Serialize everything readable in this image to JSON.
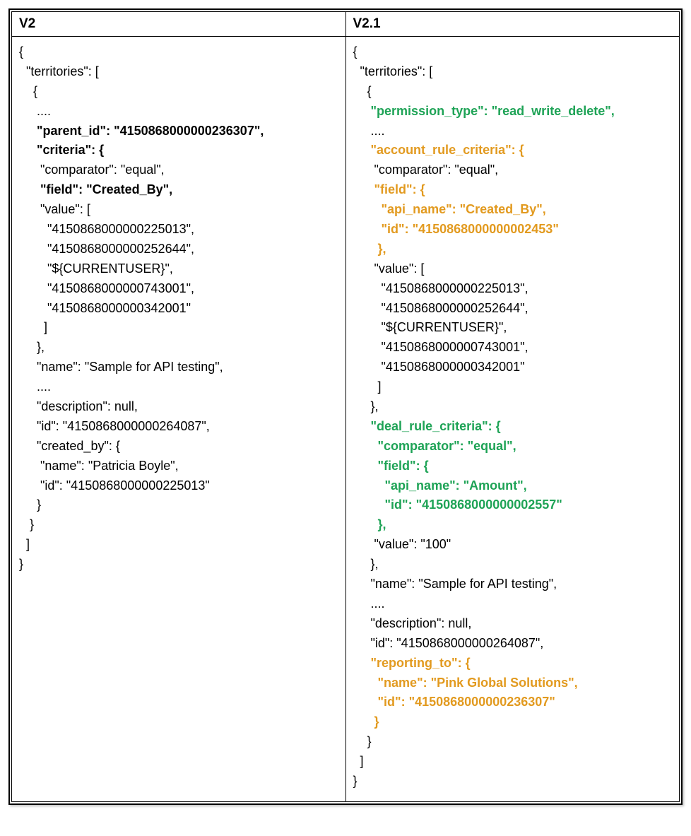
{
  "headers": {
    "left": "V2",
    "right": "V2.1"
  },
  "left": {
    "l01": "{",
    "l02": "  \"territories\": [",
    "l03": "    {",
    "l04": "     ....",
    "l05": "     \"parent_id\": \"4150868000000236307\",",
    "l06": "     \"criteria\": {",
    "l07": "      \"comparator\": \"equal\",",
    "l08": "      \"field\": \"Created_By\",",
    "l09": "      \"value\": [",
    "l10": "        \"4150868000000225013\",",
    "l11": "        \"4150868000000252644\",",
    "l12": "        \"${CURRENTUSER}\",",
    "l13": "        \"4150868000000743001\",",
    "l14": "        \"4150868000000342001\"",
    "l15": "       ]",
    "l16": "     },",
    "l17": "     \"name\": \"Sample for API testing\",",
    "l18": "     ....",
    "l19": "     \"description\": null,",
    "l20": "     \"id\": \"4150868000000264087\",",
    "l21": "     \"created_by\": {",
    "l22": "      \"name\": \"Patricia Boyle\",",
    "l23": "      \"id\": \"4150868000000225013\"",
    "l24": "     }",
    "l25": "   }",
    "l26": "  ]",
    "l27": "}"
  },
  "right": {
    "l01": "{",
    "l02": "  \"territories\": [",
    "l03": "    {",
    "l04": "     \"permission_type\": \"read_write_delete\",",
    "l05": "     ....",
    "l06": "     \"account_rule_criteria\": {",
    "l07": "      \"comparator\": \"equal\",",
    "l08a": "      ",
    "l08b": "\"field\": {",
    "l09a": "        ",
    "l09b": "\"api_name\": \"Created_By\",",
    "l10a": "        ",
    "l10b": "\"id\": \"4150868000000002453\"",
    "l11a": "       ",
    "l11b": "},",
    "l12": "      \"value\": [",
    "l13": "        \"4150868000000225013\",",
    "l14": "        \"4150868000000252644\",",
    "l15": "        \"${CURRENTUSER}\",",
    "l16": "        \"4150868000000743001\",",
    "l17": "        \"4150868000000342001\"",
    "l18": "       ]",
    "l19": "     },",
    "l20": "     \"deal_rule_criteria\": {",
    "l21": "       \"comparator\": \"equal\",",
    "l22": "       \"field\": {",
    "l23": "         \"api_name\": \"Amount\",",
    "l24": "         \"id\": \"4150868000000002557\"",
    "l25": "       },",
    "l26": "      \"value\": \"100\"",
    "l27": "     },",
    "l28": "     \"name\": \"Sample for API testing\",",
    "l29": "     ....",
    "l30": "     \"description\": null,",
    "l31": "     \"id\": \"4150868000000264087\",",
    "l32": "     \"reporting_to\": {",
    "l33": "       \"name\": \"Pink Global Solutions\",",
    "l34": "       \"id\": \"4150868000000236307\"",
    "l35": "      }",
    "l36": "    }",
    "l37": "  ]",
    "l38": "}"
  }
}
